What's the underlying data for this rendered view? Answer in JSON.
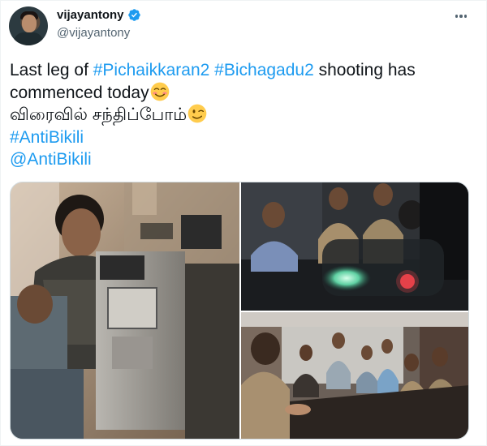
{
  "author": {
    "display_name": "vijayantony",
    "handle": "@vijayantony",
    "verified": true,
    "avatar_icon": "profile-photo"
  },
  "tweet": {
    "line1": {
      "prefix": "Last leg of ",
      "tag1": "#Pichaikkaran2",
      "space": " ",
      "tag2": "#Bichagadu2",
      "suffix": " shooting has"
    },
    "line2": {
      "text": "commenced today",
      "emoji": "smiling-face-emoji"
    },
    "line3": {
      "text": "விரைவில் சந்திப்போம்",
      "emoji": "winking-face-emoji"
    },
    "line4": {
      "hashtag": "#AntiBikili"
    },
    "line5": {
      "mention": "@AntiBikili"
    }
  },
  "media": {
    "photos": [
      {
        "name": "camera-crew-photo"
      },
      {
        "name": "police-officers-scene-photo"
      },
      {
        "name": "conference-room-scene-photo"
      }
    ]
  },
  "icons": {
    "verified": "verified-badge-icon",
    "more": "more-options-icon"
  },
  "colors": {
    "link": "#1d9bf0",
    "text": "#0f1419",
    "secondary": "#536471"
  }
}
